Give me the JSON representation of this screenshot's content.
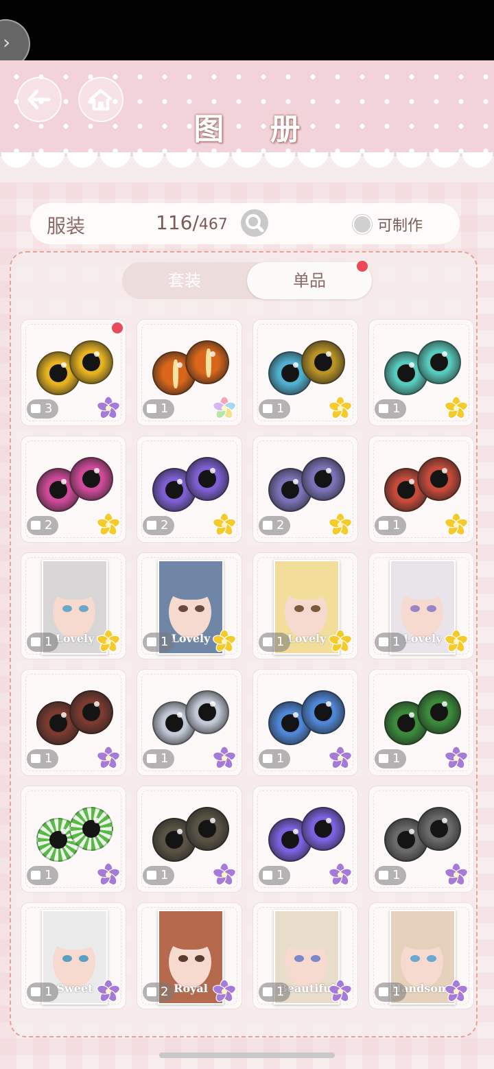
{
  "header": {
    "title": "图 册"
  },
  "collection": {
    "category": "服装",
    "owned": "116/",
    "total": "467",
    "craftable_label": "可制作"
  },
  "tabs": [
    {
      "label": "套装",
      "active": false
    },
    {
      "label": "单品",
      "active": true,
      "has_new": true
    }
  ],
  "colors": {
    "accent": "#e84a5a",
    "header": "#f3d3da",
    "panel_border": "#e1a497"
  },
  "items": [
    {
      "kind": "eyes",
      "iris": "#e6b320",
      "count": "3",
      "rarity": "purple-flower",
      "new": true
    },
    {
      "kind": "eyes",
      "iris": "#d9661a",
      "count": "1",
      "rarity": "rainbow-flower",
      "slit": true
    },
    {
      "kind": "eyes",
      "iris": "#4fb0cf",
      "iris2": "#b89224",
      "count": "1",
      "rarity": "gold-flower"
    },
    {
      "kind": "eyes",
      "iris": "#58c9bd",
      "count": "1",
      "rarity": "gold-flower"
    },
    {
      "kind": "eyes",
      "iris": "#d04a9a",
      "count": "2",
      "rarity": "gold-flower"
    },
    {
      "kind": "eyes",
      "iris": "#7d5fd2",
      "count": "2",
      "rarity": "gold-flower"
    },
    {
      "kind": "eyes",
      "iris": "#7a73b8",
      "count": "2",
      "rarity": "gold-flower"
    },
    {
      "kind": "eyes",
      "iris": "#c64a3a",
      "count": "1",
      "rarity": "gold-flower"
    },
    {
      "kind": "portrait",
      "hair": "#d8d6d6",
      "eye": "#6aa8c8",
      "word": "Lovely",
      "count": "1",
      "rarity": "gold-flower"
    },
    {
      "kind": "portrait",
      "hair": "#6f86a6",
      "eye": "#6a4a3a",
      "word": "Lovely",
      "count": "1",
      "rarity": "gold-flower"
    },
    {
      "kind": "portrait",
      "hair": "#f2de9a",
      "eye": "#7a5a3a",
      "word": "Lovely",
      "count": "1",
      "rarity": "gold-flower"
    },
    {
      "kind": "portrait",
      "hair": "#e8e4ea",
      "eye": "#9a84c8",
      "word": "Lovely",
      "count": "1",
      "rarity": "gold-flower"
    },
    {
      "kind": "eyes",
      "iris": "#7a3a30",
      "count": "1",
      "rarity": "purple-flower"
    },
    {
      "kind": "eyes",
      "iris": "#c2c8d6",
      "count": "1",
      "rarity": "purple-flower"
    },
    {
      "kind": "eyes",
      "iris": "#4f86d6",
      "count": "1",
      "rarity": "purple-flower"
    },
    {
      "kind": "eyes",
      "iris": "#3a8a3a",
      "count": "1",
      "rarity": "purple-flower"
    },
    {
      "kind": "eyes",
      "iris": "#5db84a",
      "count": "1",
      "rarity": "purple-flower",
      "swirl": true
    },
    {
      "kind": "eyes",
      "iris": "#5a5246",
      "count": "1",
      "rarity": "purple-flower"
    },
    {
      "kind": "eyes",
      "iris": "#7a62e0",
      "count": "1",
      "rarity": "purple-flower"
    },
    {
      "kind": "eyes",
      "iris": "#6a6a6a",
      "count": "1",
      "rarity": "purple-flower"
    },
    {
      "kind": "portrait",
      "hair": "#ecebeb",
      "eye": "#5aa0c0",
      "word": "Sweet",
      "count": "1",
      "rarity": "purple-flower"
    },
    {
      "kind": "portrait",
      "hair": "#b56a4e",
      "eye": "#5a3a2a",
      "word": "Royal",
      "count": "2",
      "rarity": "purple-flower"
    },
    {
      "kind": "portrait",
      "hair": "#e8dccb",
      "eye": "#7a8ac8",
      "word": "Beautiful",
      "count": "1",
      "rarity": "purple-flower"
    },
    {
      "kind": "portrait",
      "hair": "#e6d2bc",
      "eye": "#6aa8d0",
      "word": "Handsome",
      "count": "1",
      "rarity": "purple-flower"
    }
  ]
}
